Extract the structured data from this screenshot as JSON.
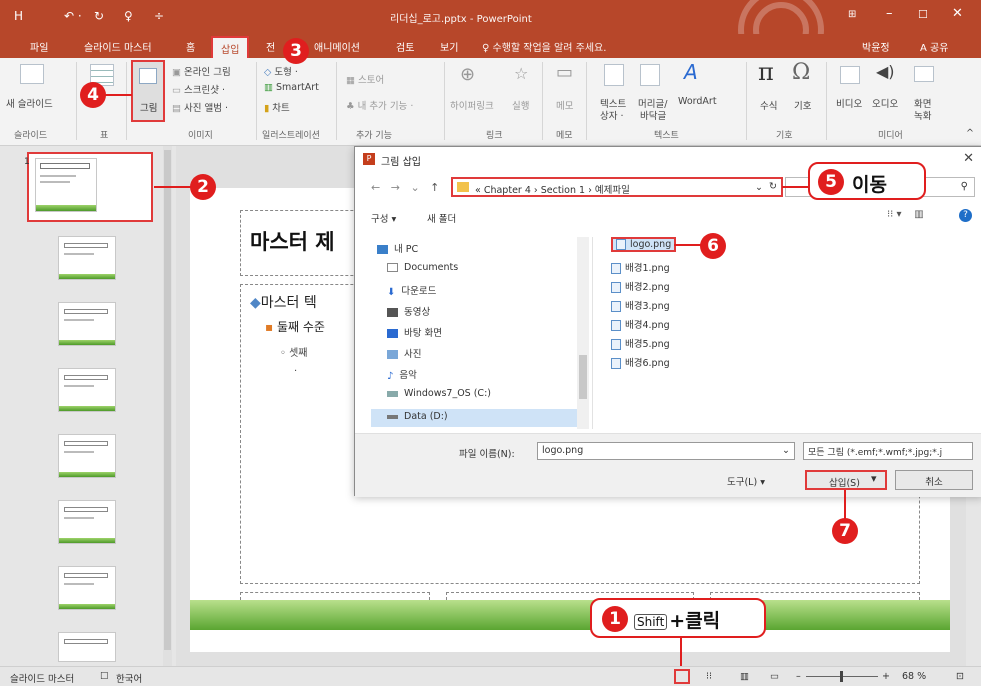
{
  "titlebar": {
    "title": "리더십_로고.pptx - PowerPoint",
    "save_icon": "H",
    "undo_icon": "↶ ·",
    "redo_icon": "↻",
    "start_icon": "♀",
    "dropdown_icon": "÷"
  },
  "tabs": {
    "file": "파일",
    "slide_master": "슬라이드 마스터",
    "home": "홈",
    "insert": "삽입",
    "transitions": "전",
    "animations": "애니메이션",
    "review": "검토",
    "view": "보기",
    "tell_me": "♀ 수행할 작업을 알려 주세요.",
    "user": "박윤정",
    "share": "A 공유"
  },
  "ribbon": {
    "new_slide": "새 슬라이드",
    "slides_group": "슬라이드",
    "table_group": "표",
    "picture": "그림",
    "online_picture": "온라인 그림",
    "screenshot": "스크린샷 ·",
    "photo_album": "사진 앨범 ·",
    "images_group": "이미지",
    "shapes": "도형 ·",
    "smartart": "SmartArt",
    "chart": "차트",
    "illustrations_group": "일러스트레이션",
    "store": "스토어",
    "my_addins": "내 추가 기능 ·",
    "addins_group": "추가 기능",
    "hyperlink": "하이퍼링크",
    "action": "실행",
    "links_group": "링크",
    "comment": "메모",
    "comments_group": "메모",
    "textbox": "텍스트",
    "header_footer": "머리글/",
    "wordart": "WordArt",
    "textbox2": "상자 ·",
    "header_footer2": "바닥글",
    "text_group": "텍스트",
    "equation": "수식",
    "symbol": "기호",
    "symbols_group": "기호",
    "video": "비디오",
    "audio": "오디오",
    "screen_recording": "화면",
    "screen_recording2": "녹화",
    "media_group": "미디어"
  },
  "slides": {
    "current_number": "1"
  },
  "slide": {
    "title": "마스터 제",
    "bullet1": "마스터 텍",
    "bullet2": "둘째 수준",
    "bullet3": "셋째",
    "bullet4": "·"
  },
  "dialog": {
    "title": "그림 삽입",
    "path": "« Chapter 4 › Section 1 › 예제파일",
    "organize": "구성 ▾",
    "new_folder": "새 폴더",
    "nav_items": [
      {
        "label": "내 PC"
      },
      {
        "label": "Documents"
      },
      {
        "label": "다운로드"
      },
      {
        "label": "동영상"
      },
      {
        "label": "바탕 화면"
      },
      {
        "label": "사진"
      },
      {
        "label": "음악"
      },
      {
        "label": "Windows7_OS (C:)"
      },
      {
        "label": "Data (D:)"
      }
    ],
    "files": [
      {
        "name": "logo.png"
      },
      {
        "name": "배경1.png"
      },
      {
        "name": "배경2.png"
      },
      {
        "name": "배경3.png"
      },
      {
        "name": "배경4.png"
      },
      {
        "name": "배경5.png"
      },
      {
        "name": "배경6.png"
      }
    ],
    "filename_label": "파일 이름(N):",
    "filename_value": "logo.png",
    "filetype": "모든 그림 (*.emf;*.wmf;*.jpg;*.j",
    "tools": "도구(L)  ▾",
    "insert": "삽입(S)",
    "cancel": "취소"
  },
  "callouts": {
    "c1": "1",
    "c1_key": "Shift",
    "c1_text": "+클릭",
    "c2": "2",
    "c3": "3",
    "c4": "4",
    "c5": "5",
    "c5_text": "이동",
    "c6": "6",
    "c7": "7"
  },
  "statusbar": {
    "view": "슬라이드 마스터",
    "language": "한국어",
    "zoom": "68 %"
  },
  "colors": {
    "accent": "#b7472a",
    "callout": "#e01e1e"
  }
}
